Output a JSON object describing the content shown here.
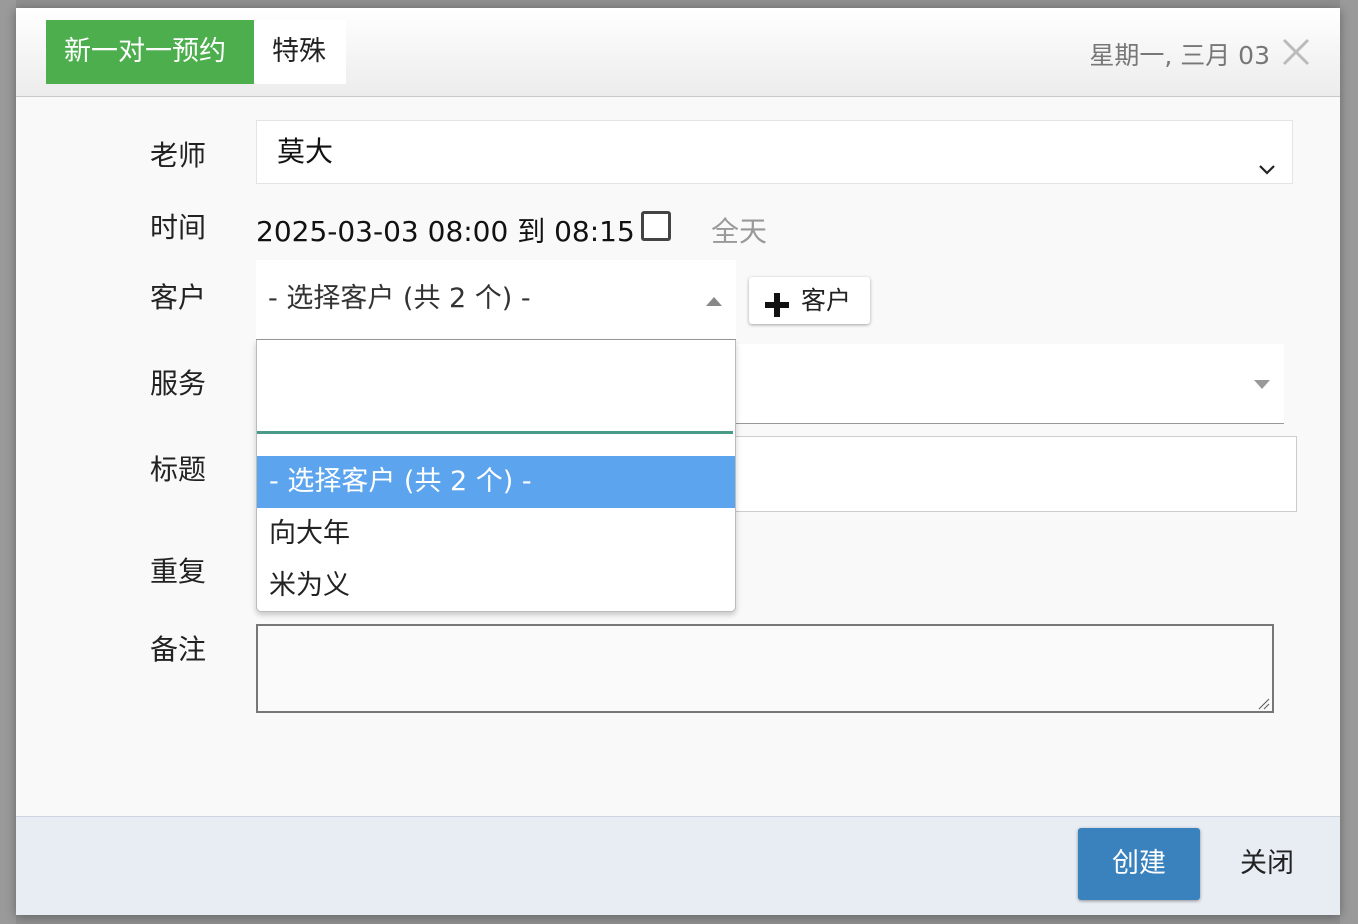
{
  "header": {
    "tab_new_appointment": "新一对一预约",
    "tab_special": "特殊",
    "date_label": "星期一, 三月 03"
  },
  "form": {
    "teacher_label": "老师",
    "teacher_value": "莫大",
    "time_label": "时间",
    "time_value": "2025-03-03 08:00 到 08:15",
    "all_day_label": "全天",
    "client_label": "客户",
    "client_selected": "- 选择客户 (共 2 个) -",
    "add_client_label": "客户",
    "service_label": "服务",
    "title_label": "标题",
    "repeat_label": "重复",
    "notes_label": "备注"
  },
  "client_dropdown": {
    "search_value": "",
    "options": [
      {
        "label": "- 选择客户 (共 2 个) -",
        "selected": true
      },
      {
        "label": "向大年",
        "selected": false
      },
      {
        "label": "米为义",
        "selected": false
      }
    ]
  },
  "footer": {
    "create_label": "创建",
    "close_label": "关闭"
  },
  "colors": {
    "active_tab": "#4cae4c",
    "primary_button": "#3a82bd",
    "dropdown_highlight": "#5ca4ed"
  }
}
